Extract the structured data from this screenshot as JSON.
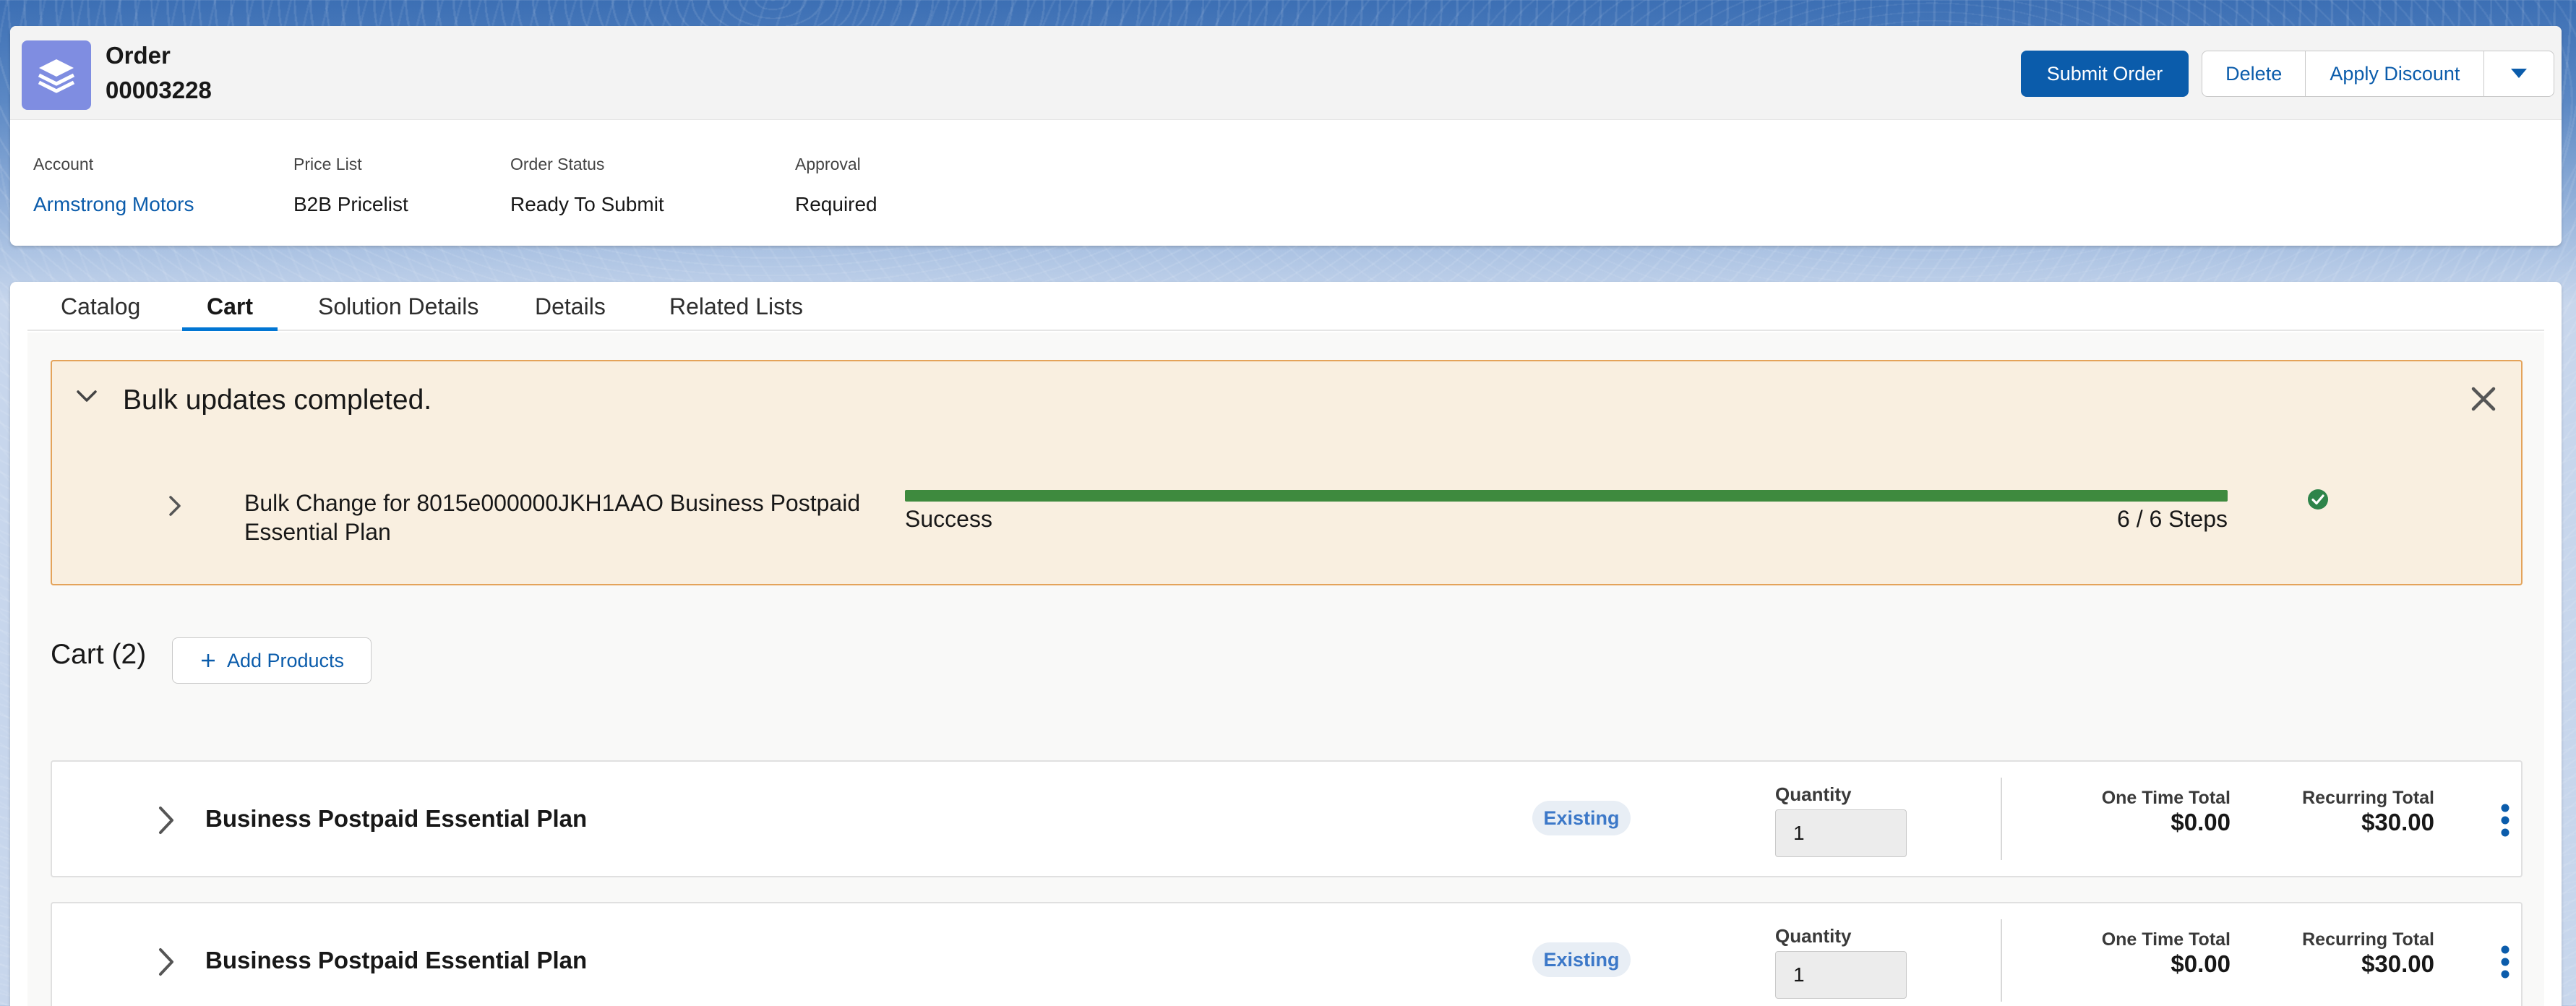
{
  "header": {
    "object_type": "Order",
    "record_number": "00003228",
    "icon": "order-stack-icon",
    "actions": {
      "submit": "Submit Order",
      "delete": "Delete",
      "apply_discount": "Apply Discount",
      "more_icon": "chevron-down-icon"
    },
    "highlights": [
      {
        "label": "Account",
        "value": "Armstrong Motors"
      },
      {
        "label": "Price List",
        "value": "B2B Pricelist"
      },
      {
        "label": "Order Status",
        "value": "Ready To Submit"
      },
      {
        "label": "Approval",
        "value": "Required"
      }
    ]
  },
  "tabs": [
    {
      "label": "Catalog"
    },
    {
      "label": "Cart"
    },
    {
      "label": "Solution Details"
    },
    {
      "label": "Details"
    },
    {
      "label": "Related Lists"
    }
  ],
  "active_tab": "Cart",
  "notice": {
    "title": "Bulk updates completed.",
    "job": {
      "label": "Bulk Change for 8015e000000JKH1AAO Business Postpaid Essential Plan",
      "status": "Success",
      "steps": "6 / 6 Steps",
      "progress_fraction": 1.0
    }
  },
  "cart": {
    "title": "Cart (2)",
    "add_products": "Add Products",
    "items": [
      {
        "name": "Business Postpaid Essential Plan",
        "badge": "Existing",
        "quantity_label": "Quantity",
        "quantity": "1",
        "one_time_label": "One Time Total",
        "one_time_total": "$0.00",
        "recurring_label": "Recurring Total",
        "recurring_total": "$30.00"
      },
      {
        "name": "Business Postpaid Essential Plan",
        "badge": "Existing",
        "quantity_label": "Quantity",
        "quantity": "1",
        "one_time_label": "One Time Total",
        "one_time_total": "$0.00",
        "recurring_label": "Recurring Total",
        "recurring_total": "$30.00"
      }
    ]
  },
  "colors": {
    "brand": "#0b5cab",
    "success": "#3e8a3e",
    "notice_bg": "#f9efe0",
    "notice_border": "#e4a35a"
  }
}
